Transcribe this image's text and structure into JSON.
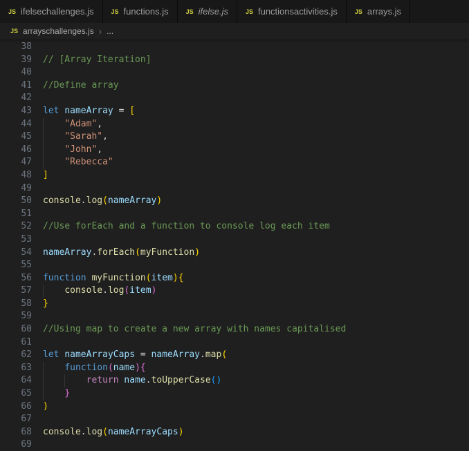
{
  "icons": {
    "js_label": "JS"
  },
  "colors": {
    "cm": "#6A9955",
    "kw": "#569CD6",
    "ctrl": "#C586C0",
    "var": "#9CDCFE",
    "fn": "#DCDCAA",
    "str": "#CE9178",
    "pn": "#D4D4D4",
    "b1": "#FFD700",
    "b2": "#DA70D6",
    "b3": "#179FFF",
    "js_icon": "#CBCB41",
    "editor_bg": "#1F1F1F",
    "tabbar_bg": "#181818"
  },
  "tabs": [
    {
      "label": "ifelsechallenges.js",
      "italic": false
    },
    {
      "label": "functions.js",
      "italic": false
    },
    {
      "label": "ifelse.js",
      "italic": true
    },
    {
      "label": "functionsactivities.js",
      "italic": false
    },
    {
      "label": "arrays.js",
      "italic": false
    }
  ],
  "breadcrumb": {
    "file": "arrayschallenges.js",
    "separator": "›",
    "ellipsis": "..."
  },
  "editor": {
    "lines": [
      {
        "n": 38,
        "t": []
      },
      {
        "n": 39,
        "t": [
          [
            "// [Array Iteration]",
            "cm"
          ]
        ]
      },
      {
        "n": 40,
        "t": []
      },
      {
        "n": 41,
        "t": [
          [
            "//Define array",
            "cm"
          ]
        ]
      },
      {
        "n": 42,
        "t": []
      },
      {
        "n": 43,
        "t": [
          [
            "let ",
            "kw"
          ],
          [
            "nameArray",
            "var"
          ],
          [
            " = ",
            "pn"
          ],
          [
            "[",
            "b1"
          ]
        ]
      },
      {
        "n": 44,
        "g": [
          0
        ],
        "t": [
          [
            "    ",
            "pn"
          ],
          [
            "\"Adam\"",
            "str"
          ],
          [
            ",",
            "pn"
          ]
        ]
      },
      {
        "n": 45,
        "g": [
          0
        ],
        "t": [
          [
            "    ",
            "pn"
          ],
          [
            "\"Sarah\"",
            "str"
          ],
          [
            ",",
            "pn"
          ]
        ]
      },
      {
        "n": 46,
        "g": [
          0
        ],
        "t": [
          [
            "    ",
            "pn"
          ],
          [
            "\"John\"",
            "str"
          ],
          [
            ",",
            "pn"
          ]
        ]
      },
      {
        "n": 47,
        "g": [
          0
        ],
        "t": [
          [
            "    ",
            "pn"
          ],
          [
            "\"Rebecca\"",
            "str"
          ]
        ]
      },
      {
        "n": 48,
        "t": [
          [
            "]",
            "b1"
          ]
        ]
      },
      {
        "n": 49,
        "t": []
      },
      {
        "n": 50,
        "t": [
          [
            "console",
            "fn"
          ],
          [
            ".",
            "pn"
          ],
          [
            "log",
            "fn"
          ],
          [
            "(",
            "b1"
          ],
          [
            "nameArray",
            "var"
          ],
          [
            ")",
            "b1"
          ]
        ]
      },
      {
        "n": 51,
        "t": []
      },
      {
        "n": 52,
        "t": [
          [
            "//Use forEach and a function to console log each item",
            "cm"
          ]
        ]
      },
      {
        "n": 53,
        "t": []
      },
      {
        "n": 54,
        "t": [
          [
            "nameArray",
            "var"
          ],
          [
            ".",
            "pn"
          ],
          [
            "forEach",
            "fn"
          ],
          [
            "(",
            "b1"
          ],
          [
            "myFunction",
            "fn"
          ],
          [
            ")",
            "b1"
          ]
        ]
      },
      {
        "n": 55,
        "t": []
      },
      {
        "n": 56,
        "t": [
          [
            "function ",
            "kw"
          ],
          [
            "myFunction",
            "fn"
          ],
          [
            "(",
            "b1"
          ],
          [
            "item",
            "var"
          ],
          [
            ")",
            "b1"
          ],
          [
            "{",
            "b1"
          ]
        ]
      },
      {
        "n": 57,
        "g": [
          0
        ],
        "t": [
          [
            "    ",
            "pn"
          ],
          [
            "console",
            "fn"
          ],
          [
            ".",
            "pn"
          ],
          [
            "log",
            "fn"
          ],
          [
            "(",
            "b2"
          ],
          [
            "item",
            "var"
          ],
          [
            ")",
            "b2"
          ]
        ]
      },
      {
        "n": 58,
        "t": [
          [
            "}",
            "b1"
          ]
        ]
      },
      {
        "n": 59,
        "t": []
      },
      {
        "n": 60,
        "t": [
          [
            "//Using map to create a new array with names capitalised",
            "cm"
          ]
        ]
      },
      {
        "n": 61,
        "t": []
      },
      {
        "n": 62,
        "t": [
          [
            "let ",
            "kw"
          ],
          [
            "nameArrayCaps",
            "var"
          ],
          [
            " = ",
            "pn"
          ],
          [
            "nameArray",
            "var"
          ],
          [
            ".",
            "pn"
          ],
          [
            "map",
            "fn"
          ],
          [
            "(",
            "b1"
          ]
        ]
      },
      {
        "n": 63,
        "g": [
          0
        ],
        "t": [
          [
            "    ",
            "pn"
          ],
          [
            "function",
            "kw"
          ],
          [
            "(",
            "b2"
          ],
          [
            "name",
            "var"
          ],
          [
            ")",
            "b2"
          ],
          [
            "{",
            "b2"
          ]
        ]
      },
      {
        "n": 64,
        "g": [
          0,
          1
        ],
        "t": [
          [
            "        ",
            "pn"
          ],
          [
            "return ",
            "ctrl"
          ],
          [
            "name",
            "var"
          ],
          [
            ".",
            "pn"
          ],
          [
            "toUpperCase",
            "fn"
          ],
          [
            "(",
            "b3"
          ],
          [
            ")",
            "b3"
          ]
        ]
      },
      {
        "n": 65,
        "g": [
          0
        ],
        "t": [
          [
            "    ",
            "pn"
          ],
          [
            "}",
            "b2"
          ]
        ]
      },
      {
        "n": 66,
        "t": [
          [
            ")",
            "b1"
          ]
        ]
      },
      {
        "n": 67,
        "t": []
      },
      {
        "n": 68,
        "t": [
          [
            "console",
            "fn"
          ],
          [
            ".",
            "pn"
          ],
          [
            "log",
            "fn"
          ],
          [
            "(",
            "b1"
          ],
          [
            "nameArrayCaps",
            "var"
          ],
          [
            ")",
            "b1"
          ]
        ]
      },
      {
        "n": 69,
        "t": []
      }
    ]
  }
}
